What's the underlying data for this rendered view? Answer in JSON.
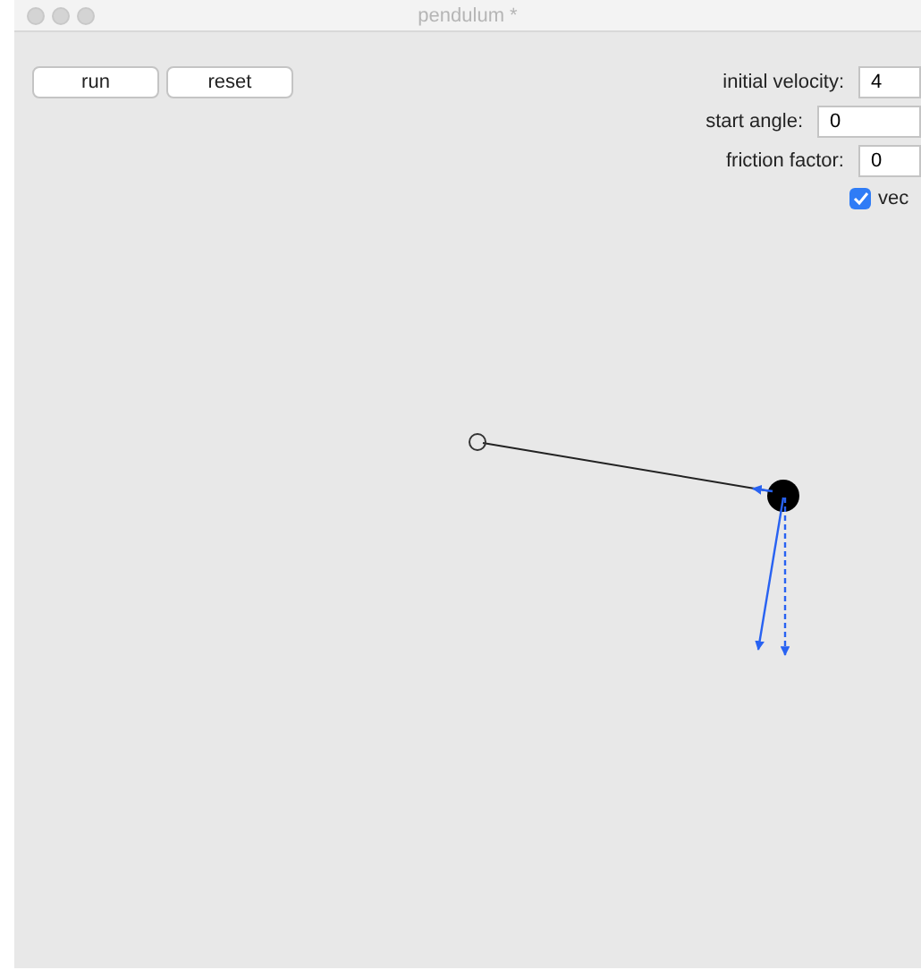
{
  "window": {
    "title": "pendulum *"
  },
  "buttons": [
    {
      "label": "run"
    },
    {
      "label": "reset"
    }
  ],
  "params": [
    {
      "label": "initial velocity:",
      "value": "4"
    },
    {
      "label": "start angle:",
      "value": "0"
    },
    {
      "label": "friction factor:",
      "value": "0"
    }
  ],
  "vectors_checkbox": {
    "label": "vec",
    "checked": true
  }
}
